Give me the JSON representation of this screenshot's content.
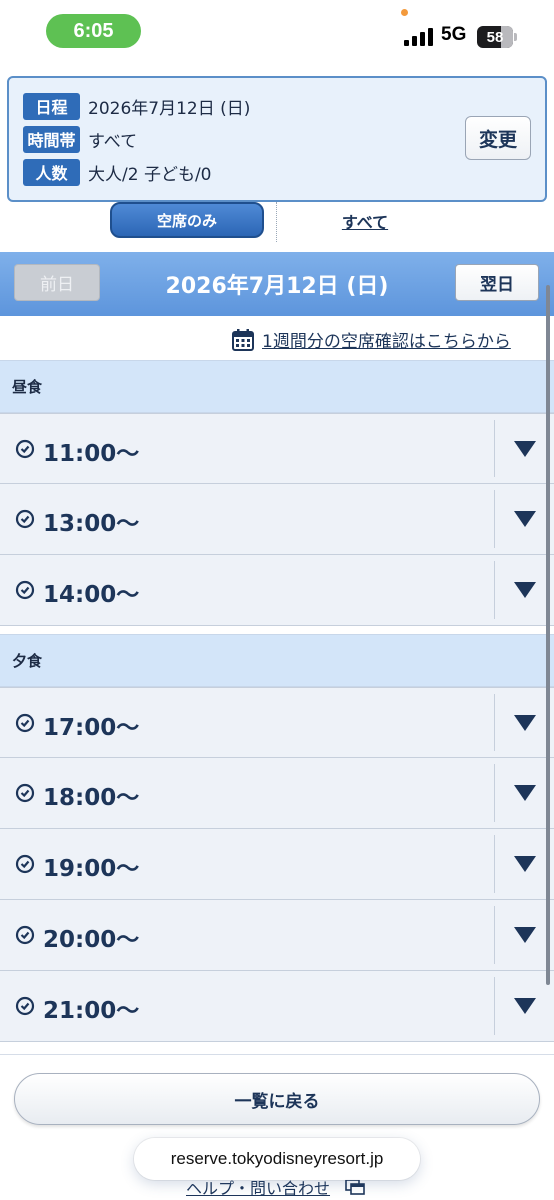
{
  "status_bar": {
    "time": "6:05",
    "network": "5G",
    "battery": "58",
    "battery_level": 0.58,
    "signal_bars": 4
  },
  "summary": {
    "rows": [
      {
        "label": "日程",
        "value": "2026年7月12日 (日)"
      },
      {
        "label": "時間帯",
        "value": "すべて"
      },
      {
        "label": "人数",
        "value": "大人/2 子ども/0"
      }
    ],
    "change_button": "変更"
  },
  "filter": {
    "available_only": "空席のみ",
    "all": "すべて",
    "selected": "空席のみ"
  },
  "date_nav": {
    "prev": "前日",
    "date": "2026年7月12日 (日)",
    "next": "翌日"
  },
  "week_link": "1週間分の空席確認はこちらから",
  "sections": [
    {
      "title": "昼食",
      "slots": [
        "11:00〜",
        "13:00〜",
        "14:00〜"
      ]
    },
    {
      "title": "夕食",
      "slots": [
        "17:00〜",
        "18:00〜",
        "19:00〜",
        "20:00〜",
        "21:00〜"
      ]
    }
  ],
  "back_button": "一覧に戻る",
  "help_link": "ヘルプ・問い合わせ",
  "url": "reserve.tokyodisneyresort.jp",
  "colors": {
    "primary": "#2f6cb8",
    "header_band": "#6ba0e2",
    "section_bg": "#d3e5f9",
    "row_bg": "#eef2f8",
    "text": "#1d3559"
  }
}
